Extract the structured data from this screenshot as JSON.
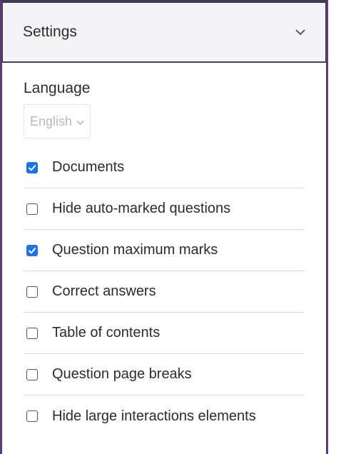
{
  "header": {
    "title": "Settings",
    "toggle_icon": "chevron-down-icon"
  },
  "language": {
    "label": "Language",
    "selected": "English",
    "dropdown_icon": "chevron-down-icon"
  },
  "options": [
    {
      "label": "Documents",
      "checked": true
    },
    {
      "label": "Hide auto-marked questions",
      "checked": false
    },
    {
      "label": "Question maximum marks",
      "checked": true
    },
    {
      "label": "Correct answers",
      "checked": false
    },
    {
      "label": "Table of contents",
      "checked": false
    },
    {
      "label": "Question page breaks",
      "checked": false
    },
    {
      "label": "Hide large interactions elements",
      "checked": false
    }
  ],
  "colors": {
    "accent": "#1a73e8",
    "frame": "#5b3a7a",
    "header_bg": "#f4f3f6"
  }
}
